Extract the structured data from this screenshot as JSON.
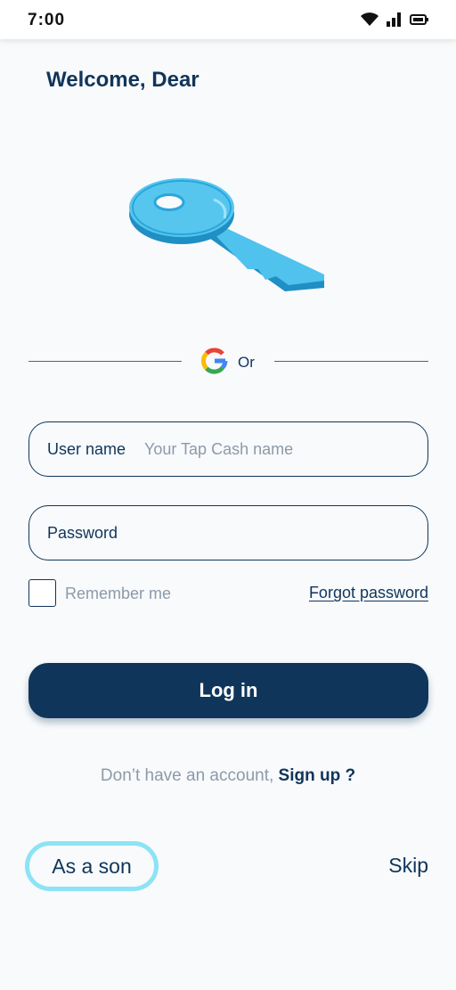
{
  "status_bar": {
    "time": "7:00",
    "icons": [
      "wifi-icon",
      "signal-icon",
      "battery-icon"
    ]
  },
  "header": {
    "welcome": "Welcome, Dear"
  },
  "divider": {
    "or_text": "Or",
    "provider_icon": "google-icon"
  },
  "form": {
    "username": {
      "label": "User name",
      "placeholder": "Your Tap Cash name",
      "value": ""
    },
    "password": {
      "label": "Password",
      "value": ""
    },
    "remember_me": {
      "label": "Remember me",
      "checked": false
    },
    "forgot_password": "Forgot password",
    "login_label": "Log in"
  },
  "signup": {
    "prompt": "Don’t have an account,",
    "link": "Sign up ?"
  },
  "footer": {
    "as_son": "As a son",
    "skip": "Skip"
  },
  "colors": {
    "primary": "#10355a",
    "muted": "#8d9aa8",
    "accent": "#8de3f6",
    "background": "#f8fafc"
  }
}
